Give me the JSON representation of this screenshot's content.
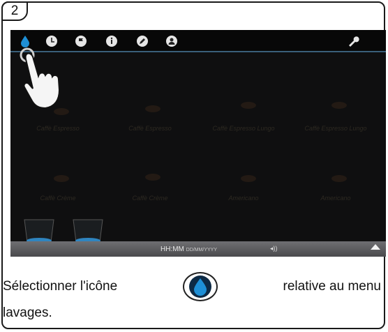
{
  "step": {
    "number": "2"
  },
  "toolbar": {
    "icons": [
      "water-drop-icon",
      "clock-icon",
      "flag-icon",
      "info-icon",
      "pencil-icon",
      "user-profile-icon",
      "wrench-icon"
    ],
    "selected": "water-drop-icon"
  },
  "beverages": {
    "row1": [
      "Caffè Espresso",
      "Caffè Espresso",
      "Caffè Espresso Lungo",
      "Caffè Espresso Lungo"
    ],
    "row2": [
      "Caffè Crème",
      "Caffè Crème",
      "Americano",
      "Americano"
    ]
  },
  "statusbar": {
    "time": "HH:MM",
    "date": "DD/MM/YYYY",
    "volume_symbol": "◂))"
  },
  "instruction": {
    "before": "Sélectionner l'icône",
    "after": "relative au menu",
    "line2": "lavages."
  },
  "colors": {
    "accent": "#1e8fd6",
    "screen_bg": "#0f0f10",
    "topbar_line": "#3a5f7a"
  }
}
